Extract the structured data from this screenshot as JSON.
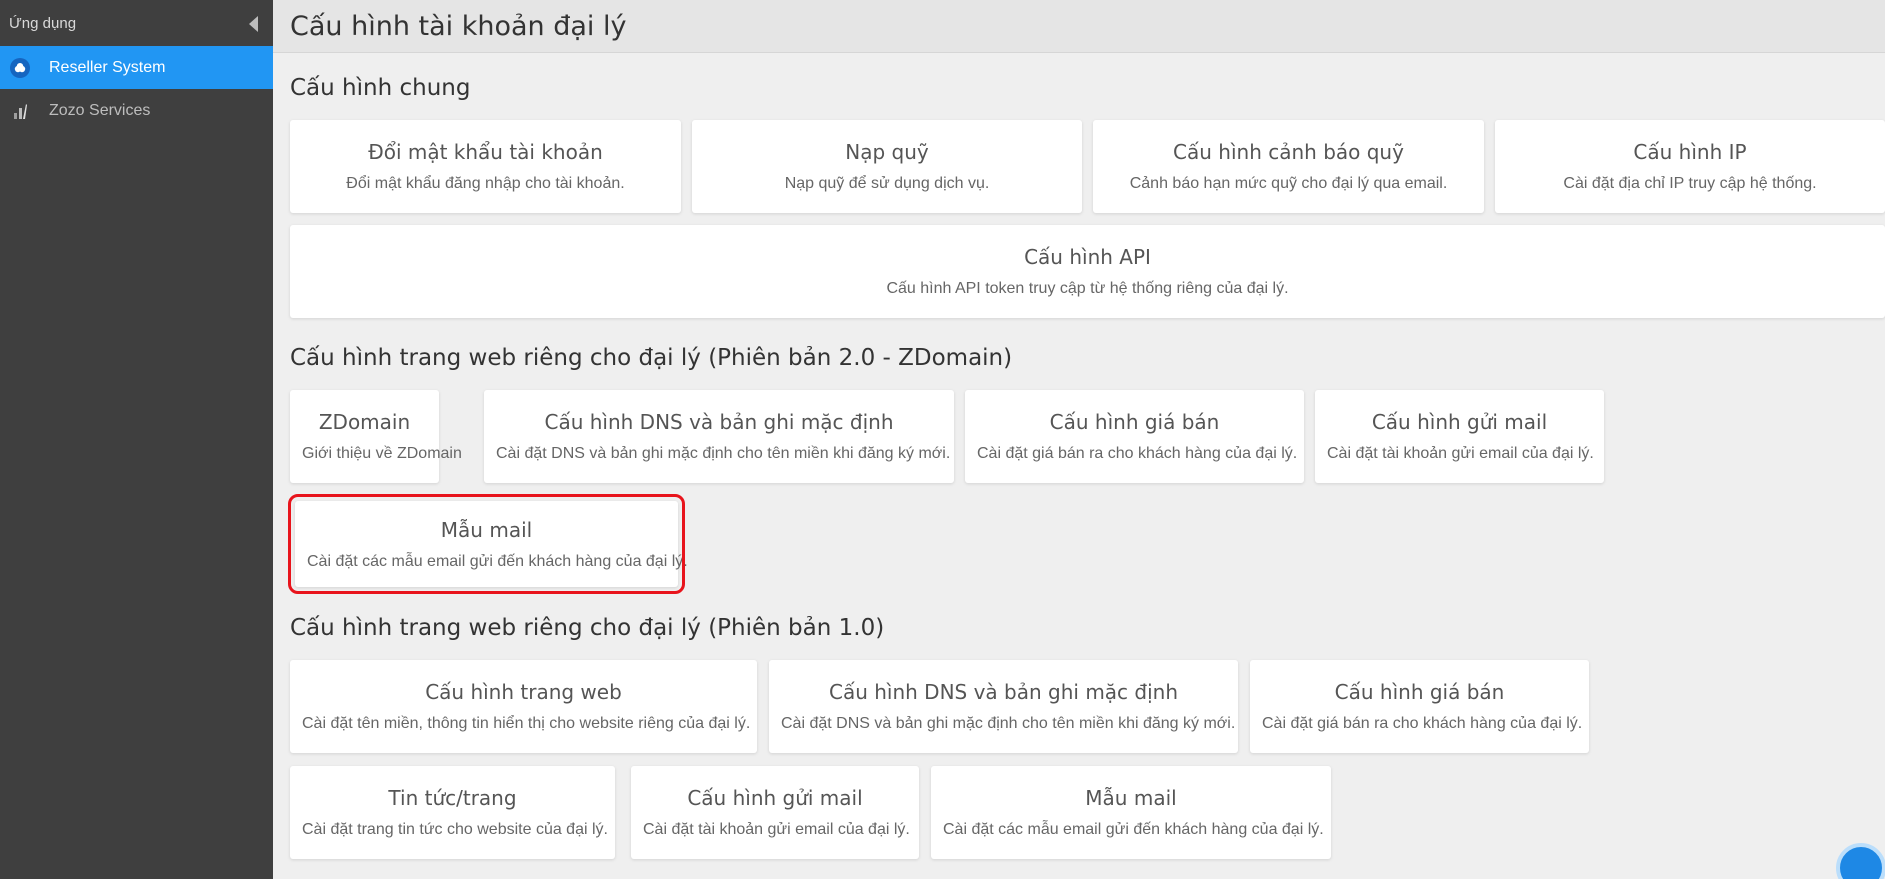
{
  "sidebar": {
    "header": "Ứng dụng",
    "items": [
      {
        "label": "Reseller System",
        "active": true,
        "icon": "cloud-icon"
      },
      {
        "label": "Zozo Services",
        "active": false,
        "icon": "chart-icon"
      }
    ]
  },
  "page": {
    "title": "Cấu hình tài khoản đại lý"
  },
  "sections": [
    {
      "title": "Cấu hình chung",
      "cards": [
        {
          "title": "Đổi mật khẩu tài khoản",
          "desc": "Đổi mật khẩu đăng nhập cho tài khoản."
        },
        {
          "title": "Nạp quỹ",
          "desc": "Nạp quỹ để sử dụng dịch vụ."
        },
        {
          "title": "Cấu hình cảnh báo quỹ",
          "desc": "Cảnh báo hạn mức quỹ cho đại lý qua email."
        },
        {
          "title": "Cấu hình IP",
          "desc": "Cài đặt địa chỉ IP truy cập hệ thống."
        },
        {
          "title": "Cấu hình API",
          "desc": "Cấu hình API token truy cập từ hệ thống riêng của đại lý."
        }
      ]
    },
    {
      "title": "Cấu hình trang web riêng cho đại lý (Phiên bản 2.0 - ZDomain)",
      "cards": [
        {
          "title": "ZDomain",
          "desc": "Giới thiệu về ZDomain"
        },
        {
          "title": "Cấu hình DNS và bản ghi mặc định",
          "desc": "Cài đặt DNS và bản ghi mặc định cho tên miền khi đăng ký mới."
        },
        {
          "title": "Cấu hình giá bán",
          "desc": "Cài đặt giá bán ra cho khách hàng của đại lý."
        },
        {
          "title": "Cấu hình gửi mail",
          "desc": "Cài đặt tài khoản gửi email của đại lý."
        },
        {
          "title": "Mẫu mail",
          "desc": "Cài đặt các mẫu email gửi đến khách hàng của đại lý."
        }
      ]
    },
    {
      "title": "Cấu hình trang web riêng cho đại lý (Phiên bản 1.0)",
      "cards": [
        {
          "title": "Cấu hình trang web",
          "desc": "Cài đặt tên miền, thông tin hiển thị cho website riêng của đại lý."
        },
        {
          "title": "Cấu hình DNS và bản ghi mặc định",
          "desc": "Cài đặt DNS và bản ghi mặc định cho tên miền khi đăng ký mới."
        },
        {
          "title": "Cấu hình giá bán",
          "desc": "Cài đặt giá bán ra cho khách hàng của đại lý."
        },
        {
          "title": "Tin tức/trang",
          "desc": "Cài đặt trang tin tức cho website của đại lý."
        },
        {
          "title": "Cấu hình gửi mail",
          "desc": "Cài đặt tài khoản gửi email của đại lý."
        },
        {
          "title": "Mẫu mail",
          "desc": "Cài đặt các mẫu email gửi đến khách hàng của đại lý."
        }
      ]
    }
  ],
  "colors": {
    "sidebar_bg": "#3f3f3f",
    "active_item": "#2196f3",
    "highlight_border": "#e8141c"
  }
}
